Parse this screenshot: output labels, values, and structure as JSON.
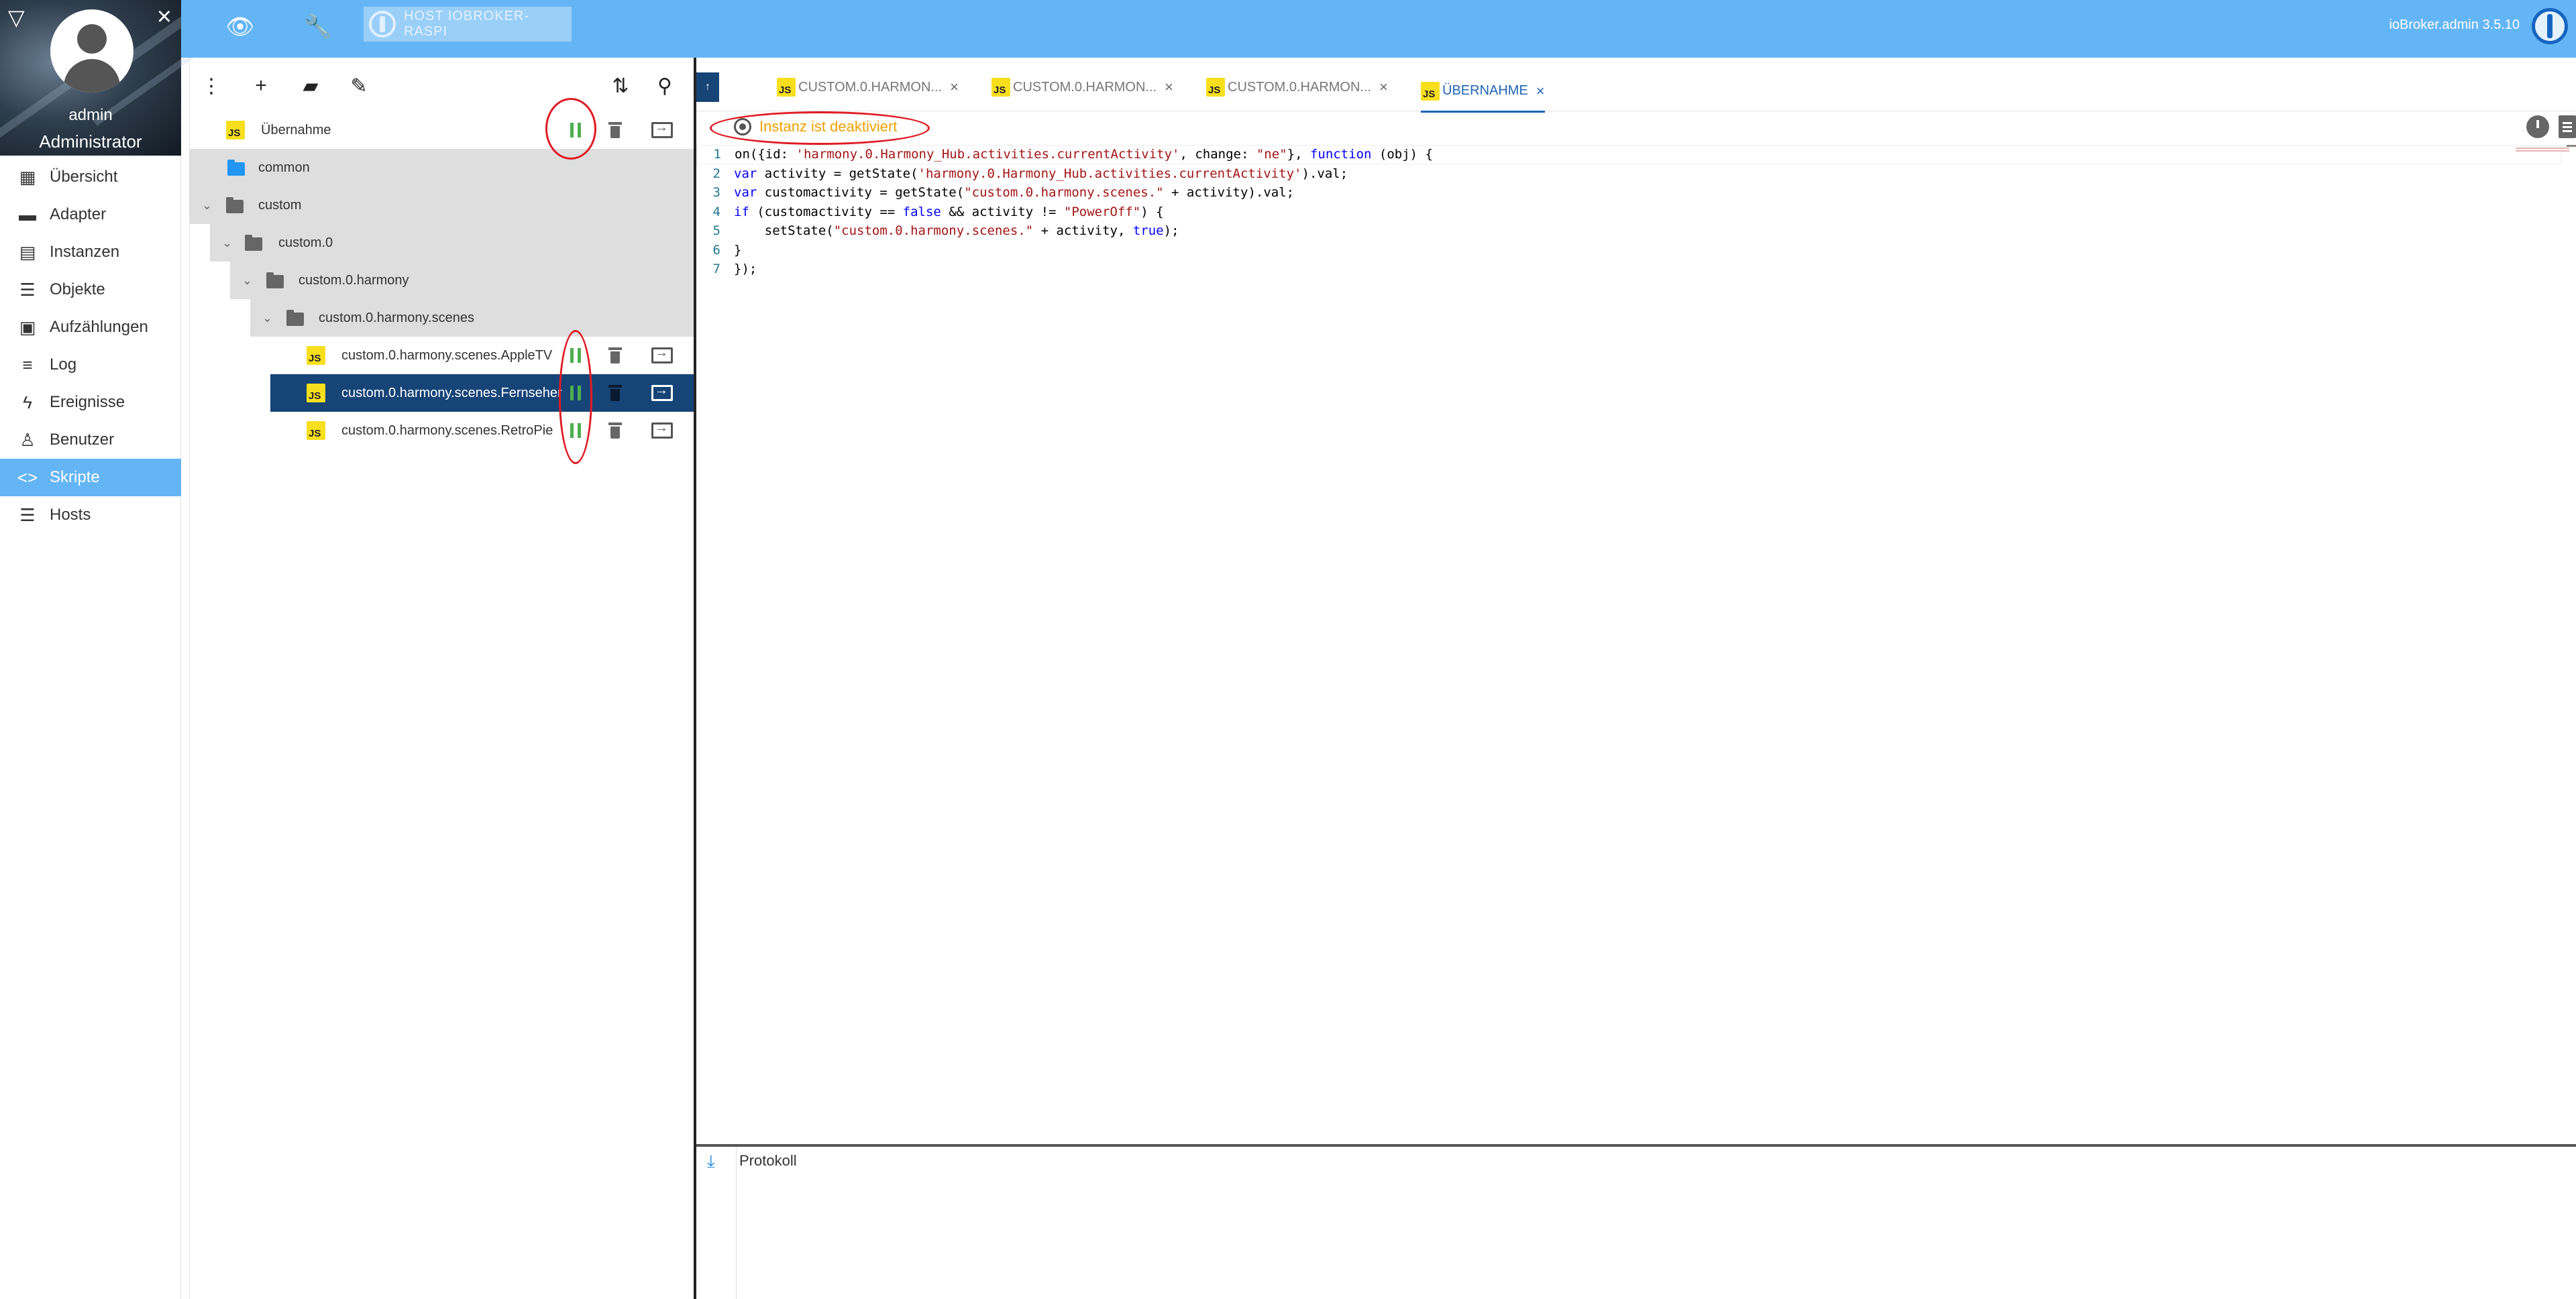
{
  "sidebar": {
    "user_name": "admin",
    "user_role": "Administrator",
    "items": [
      {
        "label": "Übersicht",
        "icon": "grid-icon"
      },
      {
        "label": "Adapter",
        "icon": "store-icon"
      },
      {
        "label": "Instanzen",
        "icon": "instances-icon"
      },
      {
        "label": "Objekte",
        "icon": "list-icon"
      },
      {
        "label": "Aufzählungen",
        "icon": "enum-icon"
      },
      {
        "label": "Log",
        "icon": "log-icon"
      },
      {
        "label": "Ereignisse",
        "icon": "bolt-icon"
      },
      {
        "label": "Benutzer",
        "icon": "user-icon"
      },
      {
        "label": "Skripte",
        "icon": "code-icon",
        "active": true
      },
      {
        "label": "Hosts",
        "icon": "hosts-icon"
      }
    ]
  },
  "topbar": {
    "host_label": "HOST IOBROKER-RASPI",
    "version": "ioBroker.admin 3.5.10",
    "accent_color": "#64b5f6"
  },
  "tree": {
    "rows": [
      {
        "label": "Übernahme",
        "type": "script"
      },
      {
        "label": "common",
        "type": "folder"
      },
      {
        "label": "custom",
        "type": "folder"
      },
      {
        "label": "custom.0",
        "type": "folder"
      },
      {
        "label": "custom.0.harmony",
        "type": "folder"
      },
      {
        "label": "custom.0.harmony.scenes",
        "type": "folder"
      },
      {
        "label": "custom.0.harmony.scenes.AppleTV",
        "type": "script"
      },
      {
        "label": "custom.0.harmony.scenes.Fernseher",
        "type": "script",
        "selected": true
      },
      {
        "label": "custom.0.harmony.scenes.RetroPie",
        "type": "script"
      }
    ]
  },
  "editor": {
    "tabs": [
      {
        "label": "CUSTOM.0.HARMON..."
      },
      {
        "label": "CUSTOM.0.HARMON..."
      },
      {
        "label": "CUSTOM.0.HARMON..."
      },
      {
        "label": "ÜBERNAHME",
        "active": true
      }
    ],
    "status": "Instanz ist deaktiviert",
    "log_label": "Protokoll"
  },
  "code_lines": [
    "on({id: 'harmony.0.Harmony_Hub.activities.currentActivity', change: \"ne\"}, function (obj) {",
    "var activity = getState('harmony.0.Harmony_Hub.activities.currentActivity').val;",
    "var customactivity = getState(\"custom.0.harmony.scenes.\" + activity).val;",
    "if (customactivity == false && activity != \"PowerOff\") {",
    "    setState(\"custom.0.harmony.scenes.\" + activity, true);",
    "}",
    "});"
  ],
  "colors": {
    "selected_row": "#164477",
    "pause_green": "#4caf50",
    "annotation_red": "#e01b24",
    "status_orange": "#f0a000"
  }
}
